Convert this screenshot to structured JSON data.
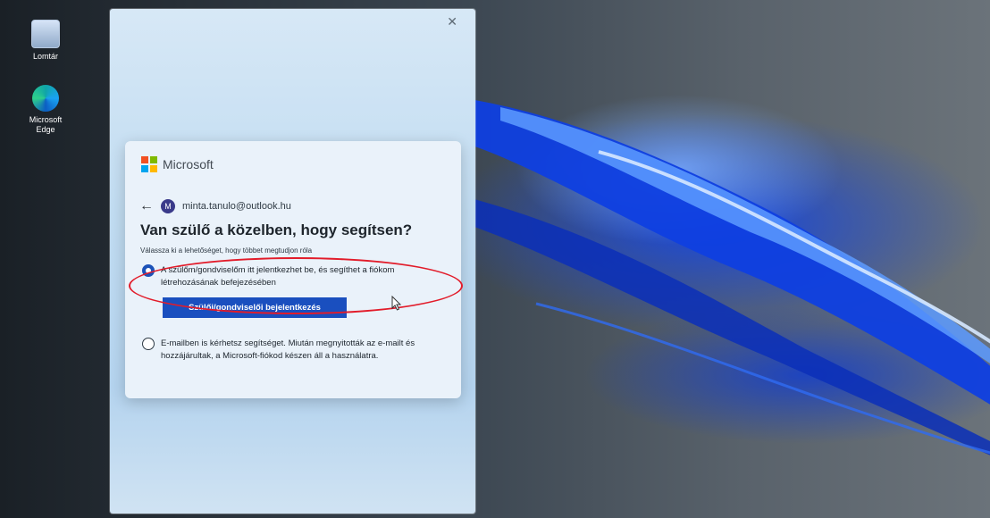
{
  "desktop": {
    "icons": [
      {
        "label": "Lomtár",
        "icon": "recycle-bin-icon"
      },
      {
        "label": "Microsoft Edge",
        "icon": "edge-icon"
      }
    ]
  },
  "frame": {
    "close_icon": "close-icon",
    "close_glyph": "✕"
  },
  "dialog": {
    "brand": "Microsoft",
    "back_glyph": "←",
    "avatar_initial": "M",
    "email": "minta.tanulo@outlook.hu",
    "title": "Van szülő a közelben, hogy segítsen?",
    "subtitle": "Válassza ki a lehetőséget, hogy többet megtudjon róla",
    "option1_text": "A szülőm/gondviselőm itt jelentkezhet be, és segíthet a fiókom létrehozásának befejezésében",
    "option1_selected": true,
    "parent_button": "Szülői/gondviselői bejelentkezés",
    "option2_text": "E-mailben is kérhetsz segítséget. Miután megnyitották az e-mailt és hozzájárultak, a Microsoft-fiókod készen áll a használatra.",
    "option2_selected": false
  },
  "colors": {
    "accent": "#1a4fbf",
    "annotation": "#e21c2a",
    "wallpaper_blue": "#1446d8"
  }
}
